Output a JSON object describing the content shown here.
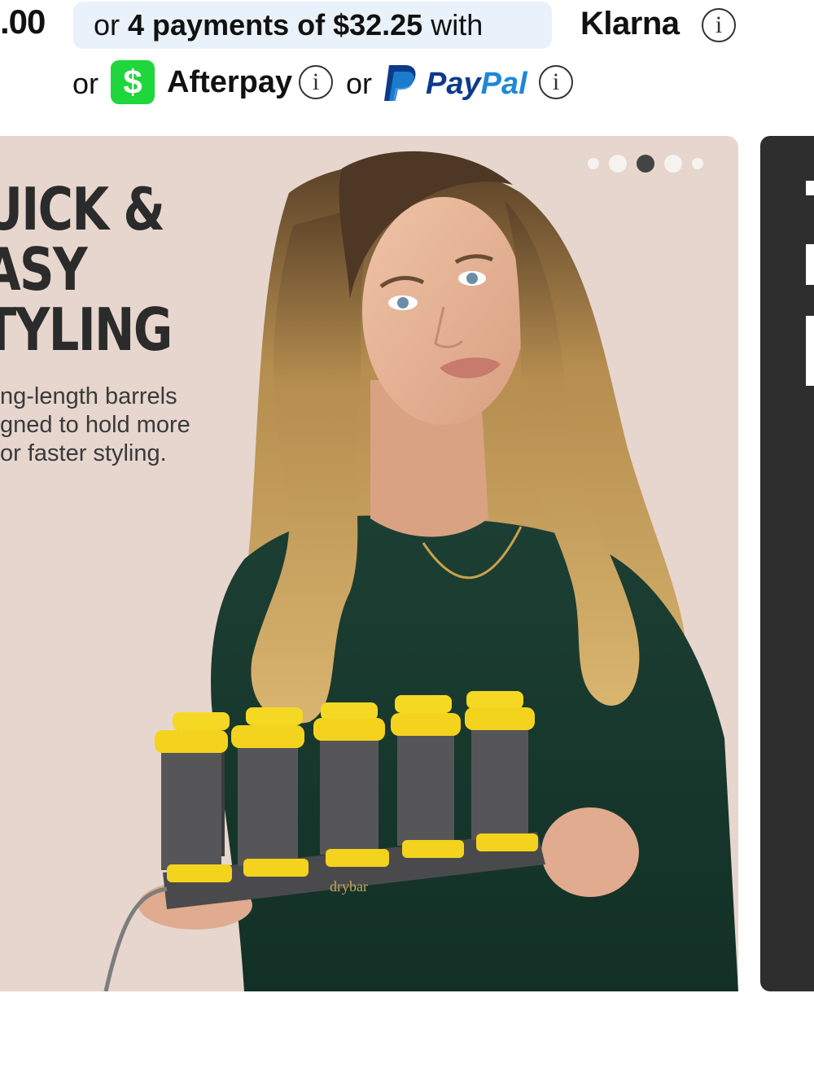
{
  "payment_bar": {
    "price_fragment": ".00",
    "klarna": {
      "prefix": "or ",
      "bold_text": "4 payments of $32.25",
      "suffix": " with",
      "logo": "Klarna",
      "info_icon": "info-icon"
    },
    "alternatives": {
      "or_1": "or",
      "cashapp_symbol": "$",
      "afterpay_logo": "Afterpay",
      "or_2": "or",
      "paypal_logo_pay": "Pay",
      "paypal_logo_pal": "Pal",
      "info_icon": "info-icon"
    },
    "colors": {
      "pill_bg": "#e9f1fb",
      "cashapp_green": "#1fd63c",
      "paypal_dark": "#0d3a8a",
      "paypal_light": "#1e88d8"
    }
  },
  "carousel": {
    "current_slide": 3,
    "slide_count": 5,
    "slide": {
      "headline_lines": [
        "UICK &",
        "ASY",
        "TYLING"
      ],
      "body_lines": [
        "ng-length barrels",
        "gned to hold more",
        "or faster styling."
      ],
      "product_logo": "drybar",
      "background": "#e6d6cd"
    },
    "next_card_bg": "#2e2e2e"
  }
}
